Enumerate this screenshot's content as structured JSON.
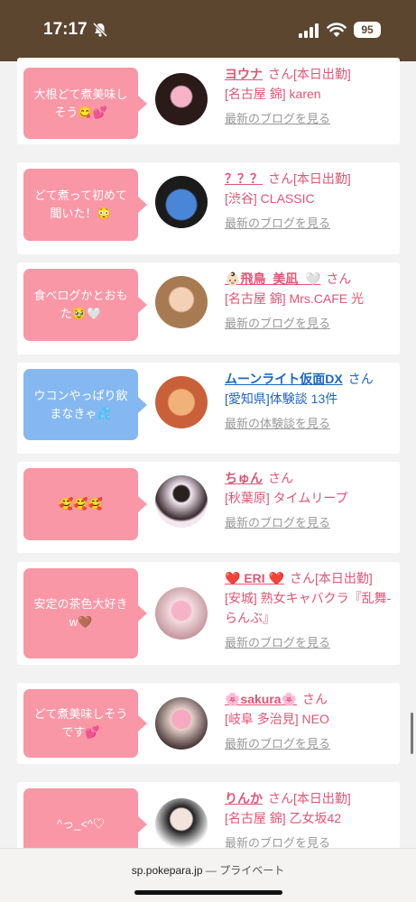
{
  "status_bar": {
    "time": "17:17",
    "battery": "95"
  },
  "browser": {
    "url": "sp.pokepara.jp",
    "mode": "— プライベート"
  },
  "cards": [
    {
      "bubble": "大根どて煮美味しそう😋💕",
      "bubble_color": "pink",
      "name": "ヨウナ",
      "san": "さん",
      "status": "[本日出勤]",
      "shop": "[名古屋 錦] karen",
      "link": "最新のブログを見る",
      "avatar_color": "#2a1a1a"
    },
    {
      "bubble": "どて煮って初めて聞いた！😳",
      "bubble_color": "pink",
      "name": "？？？",
      "san": "さん",
      "status": "[本日出勤]",
      "shop": "[渋谷] CLASSIC",
      "link": "最新のブログを見る",
      "avatar_color": "#3a6bb0"
    },
    {
      "bubble": "食べログかとおもた🥹🤍",
      "bubble_color": "pink",
      "name": "👶🏻飛鳥_美凪_🤍",
      "san": "さん",
      "status": "",
      "shop": "[名古屋 錦] Mrs.CAFE 光",
      "link": "最新のブログを見る",
      "avatar_color": "#c89a6a"
    },
    {
      "bubble": "ウコンやっぱり飲まなきゃ💦",
      "bubble_color": "blue",
      "name": "ムーンライト仮面DX",
      "san": "さん",
      "status": "",
      "shop": "[愛知県]体験談 13件",
      "link": "最新の体験談を見る",
      "avatar_color": "#d77a52"
    },
    {
      "bubble": "🥰🥰🥰",
      "bubble_color": "pink",
      "name": "ちゅん",
      "san": "さん",
      "status": "",
      "shop": "[秋葉原] タイムリープ",
      "link": "最新のブログを見る",
      "avatar_color": "#ecdde6"
    },
    {
      "bubble": "安定の茶色大好きw🤎",
      "bubble_color": "pink",
      "name": "❤️ ERI ❤️",
      "san": "さん",
      "status": "[本日出勤]",
      "shop": "[安城] 熟女キャバクラ『乱舞-らんぶ』",
      "link": "最新のブログを見る",
      "avatar_color": "#f0d0d8"
    },
    {
      "bubble": "どて煮美味しそうです💕",
      "bubble_color": "pink",
      "name": "🌸sakura🌸",
      "san": "さん",
      "status": "",
      "shop": "[岐阜 多治見] NEO",
      "link": "最新のブログを見る",
      "avatar_color": "#5a4a4a"
    },
    {
      "bubble": "^っ_<^♡",
      "bubble_color": "pink",
      "name": "りんか",
      "san": "さん",
      "status": "[本日出勤]",
      "shop": "[名古屋 錦] 乙女坂42",
      "link": "最新のブログを見る",
      "avatar_color": "#e8e8e8"
    }
  ]
}
